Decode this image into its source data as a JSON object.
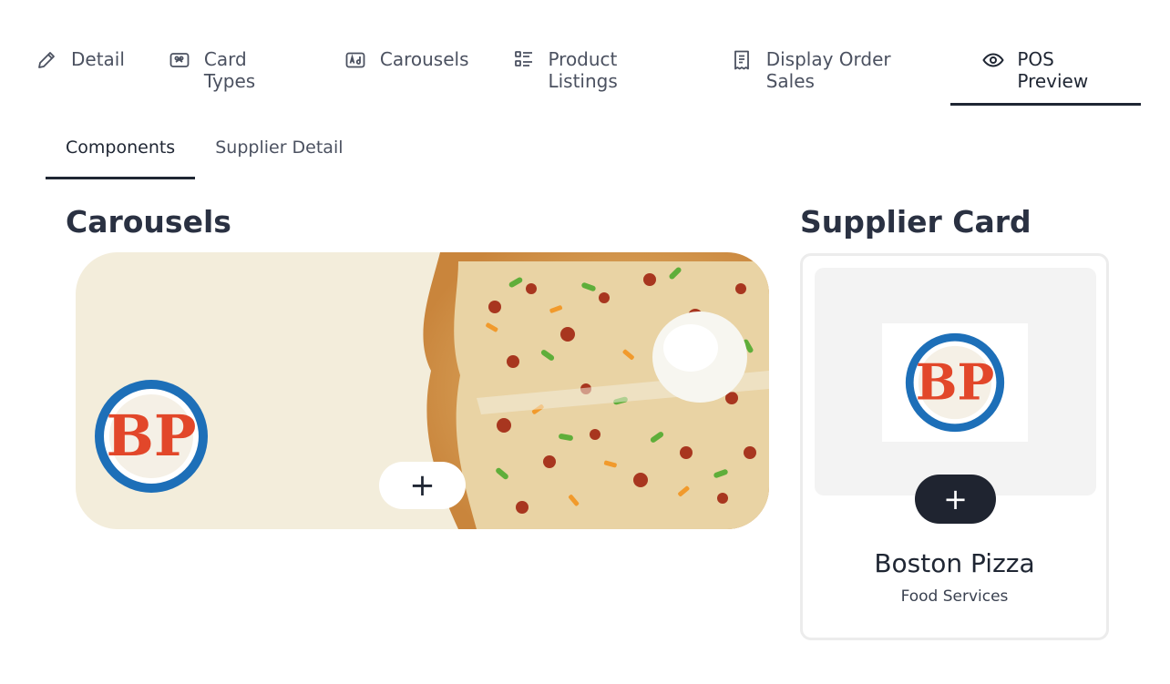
{
  "top_tabs": [
    {
      "label": "Detail",
      "icon": "pencil-icon"
    },
    {
      "label": "Card Types",
      "icon": "card-types-icon"
    },
    {
      "label": "Carousels",
      "icon": "ad-icon"
    },
    {
      "label": "Product Listings",
      "icon": "list-icon"
    },
    {
      "label": "Display Order Sales",
      "icon": "receipt-icon"
    },
    {
      "label": "POS Preview",
      "icon": "eye-icon",
      "active": true
    }
  ],
  "sub_tabs": [
    {
      "label": "Components",
      "active": true
    },
    {
      "label": "Supplier Detail"
    }
  ],
  "carousels": {
    "title": "Carousels",
    "add_label": "+",
    "logo_text": "BP"
  },
  "supplier_card": {
    "title": "Supplier Card",
    "add_label": "+",
    "logo_text": "BP",
    "name": "Boston Pizza",
    "category": "Food Services"
  },
  "colors": {
    "text": "#1f2633",
    "carousel_bg": "#f3eddb",
    "logo_red": "#e2472a",
    "logo_blue": "#1d6fb8",
    "add_button_dark": "#1f2430"
  }
}
